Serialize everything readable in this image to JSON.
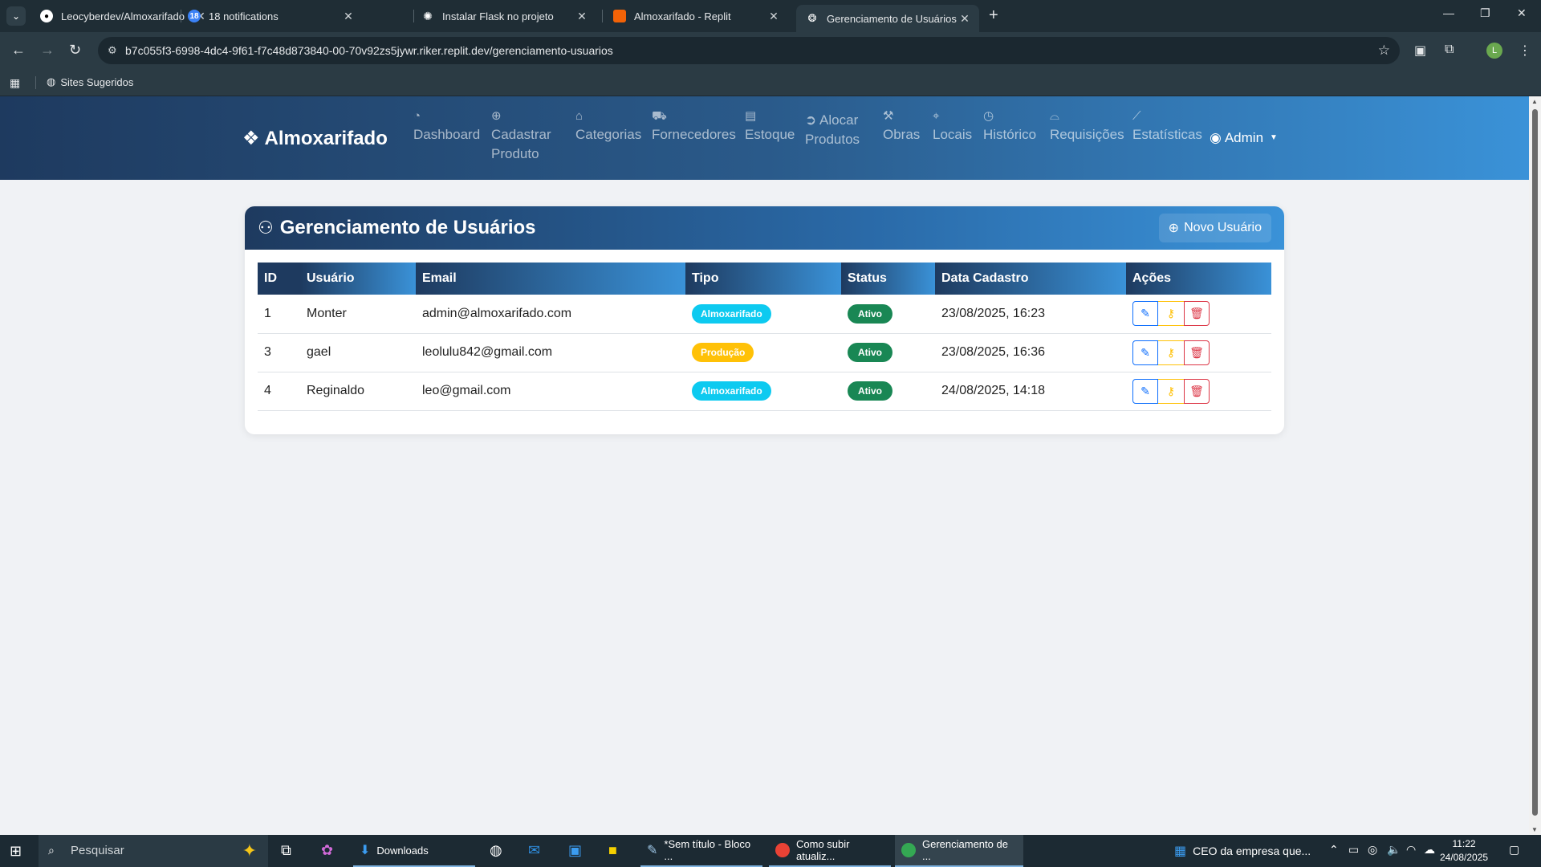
{
  "browser": {
    "tabs": [
      {
        "title": "Leocyberdev/Almoxarifado",
        "icon": "github-icon"
      },
      {
        "title": "18 notifications",
        "badge": "18"
      },
      {
        "title": "Instalar Flask no projeto",
        "icon": "chatgpt-icon"
      },
      {
        "title": "Almoxarifado - Replit",
        "icon": "replit-icon"
      },
      {
        "title": "Gerenciamento de Usuários",
        "icon": "site-icon",
        "active": true
      }
    ],
    "url": "b7c055f3-6998-4dc4-9f61-f7c48d873840-00-70v92zs5jywr.riker.replit.dev/gerenciamento-usuarios",
    "bookmark": "Sites Sugeridos",
    "profile_initial": "L"
  },
  "app": {
    "brand": "Almoxarifado",
    "nav": [
      {
        "label": "Dashboard",
        "icon": "speedometer-icon"
      },
      {
        "label": "Cadastrar Produto",
        "icon": "plus-circle-icon"
      },
      {
        "label": "Categorias",
        "icon": "tag-icon"
      },
      {
        "label": "Fornecedores",
        "icon": "truck-icon"
      },
      {
        "label": "Estoque",
        "icon": "archive-icon"
      },
      {
        "label": "Alocar Produtos",
        "icon": "arrow-right-circle-icon"
      },
      {
        "label": "Obras",
        "icon": "hammer-icon"
      },
      {
        "label": "Locais",
        "icon": "geo-pin-icon"
      },
      {
        "label": "Histórico",
        "icon": "clock-icon"
      },
      {
        "label": "Requisições",
        "icon": "inbox-icon"
      },
      {
        "label": "Estatísticas",
        "icon": "graph-icon"
      }
    ],
    "user_menu": "Admin",
    "page_title": "Gerenciamento de Usuários",
    "new_user_button": "Novo Usuário",
    "table": {
      "headers": [
        "ID",
        "Usuário",
        "Email",
        "Tipo",
        "Status",
        "Data Cadastro",
        "Ações"
      ],
      "rows": [
        {
          "id": "1",
          "user": "Monter",
          "email": "admin@almoxarifado.com",
          "type": "Almoxarifado",
          "status": "Ativo",
          "date": "23/08/2025, 16:23"
        },
        {
          "id": "3",
          "user": "gael",
          "email": "leolulu842@gmail.com",
          "type": "Produção",
          "status": "Ativo",
          "date": "23/08/2025, 16:36"
        },
        {
          "id": "4",
          "user": "Reginaldo",
          "email": "leo@gmail.com",
          "type": "Almoxarifado",
          "status": "Ativo",
          "date": "24/08/2025, 14:18"
        }
      ]
    },
    "colors": {
      "almoxarifado_badge": "#0dcaf0",
      "producao_badge": "#ffc107",
      "ativo_badge": "#198754"
    }
  },
  "taskbar": {
    "search_placeholder": "Pesquisar",
    "apps": [
      {
        "label": "Downloads"
      },
      {
        "label": "*Sem título - Bloco ..."
      },
      {
        "label": "Como subir atualiz..."
      },
      {
        "label": "Gerenciamento de ...",
        "active": true
      }
    ],
    "news": "CEO da empresa que...",
    "time": "11:22",
    "date": "24/08/2025"
  }
}
